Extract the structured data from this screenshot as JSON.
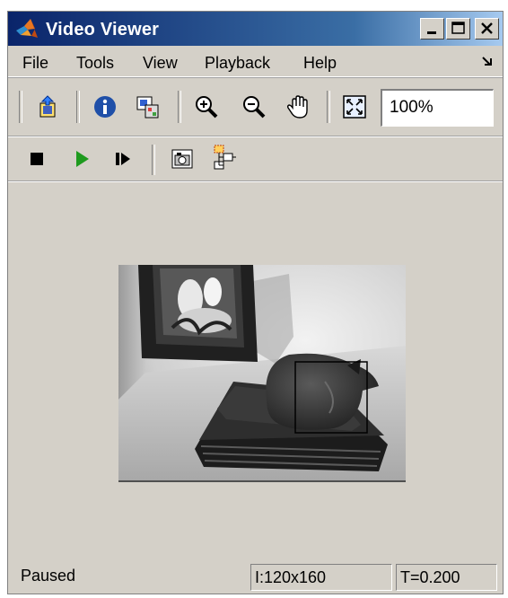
{
  "window": {
    "title": "Video Viewer"
  },
  "menubar": {
    "items": [
      "File",
      "Tools",
      "View",
      "Playback",
      "Help"
    ]
  },
  "toolbar": {
    "zoom_value": "100%"
  },
  "status": {
    "state": "Paused",
    "image_size": "I:120x160",
    "time": "T=0.200"
  },
  "icons": {
    "app": "matlab-logo-icon",
    "toolbar1": [
      "print-to-figure-icon",
      "info-icon",
      "maintain-fit-icon",
      "zoom-in-icon",
      "zoom-out-icon",
      "pan-hand-icon",
      "fit-to-view-icon"
    ],
    "toolbar2": [
      "stop-icon",
      "play-icon",
      "step-forward-icon",
      "snapshot-camera-icon",
      "highlight-block-icon"
    ]
  },
  "colors": {
    "title_gradient_start": "#0a246a",
    "title_gradient_end": "#a6caf0",
    "window_bg": "#d4d0c8",
    "play_green": "#1e9a1e"
  }
}
